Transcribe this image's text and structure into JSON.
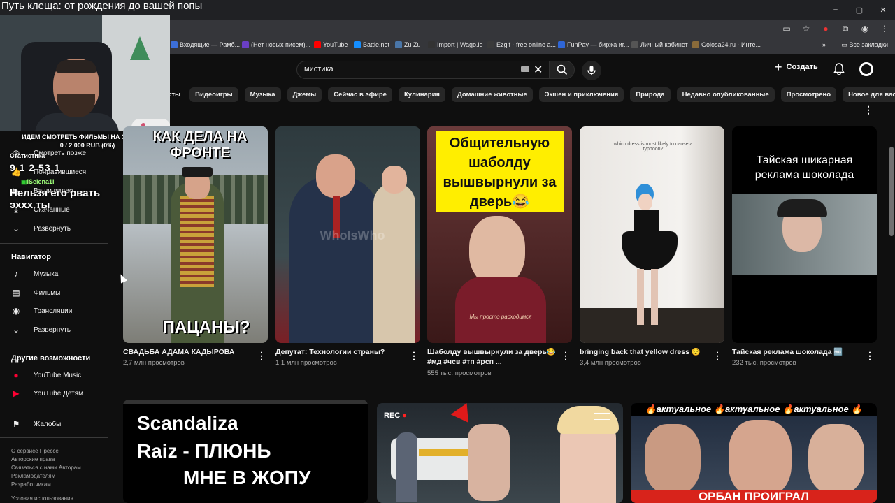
{
  "window": {
    "stream_title": "Путь клеща: от рождения до вашей попы",
    "controls": [
      "⎯",
      "▢",
      "✕"
    ]
  },
  "bookmarks": [
    {
      "label": "Входящие — Рамб...",
      "color": "#3c6fd8"
    },
    {
      "label": "(Нет новых писем)...",
      "color": "#6a3fc4"
    },
    {
      "label": "YouTube",
      "color": "#ff0000"
    },
    {
      "label": "Battle.net",
      "color": "#148eff"
    },
    {
      "label": "Zu Zu",
      "color": "#4a76a8"
    },
    {
      "label": "Import | Wago.io",
      "color": "#333333"
    },
    {
      "label": "Ezgif - free online a...",
      "color": "#3a3a3a"
    },
    {
      "label": "FunPay — биржа иг...",
      "color": "#2f66d6"
    },
    {
      "label": "Личный кабинет",
      "color": "#555555"
    },
    {
      "label": "Golosa24.ru - Инте...",
      "color": "#8a6b3a"
    }
  ],
  "bookmarks_all": "Все закладки",
  "header": {
    "search_value": "мистика",
    "create_label": "Создать"
  },
  "chips": [
    "касты",
    "Видеоигры",
    "Музыка",
    "Джемы",
    "Сейчас в эфире",
    "Кулинария",
    "Домашние животные",
    "Экшен и приключения",
    "Природа",
    "Недавно опубликованные",
    "Просмотрено",
    "Новое для вас"
  ],
  "sidebar": {
    "partial_items": [
      "Смотреть позже",
      "Понравившиеся",
      "Ваши видео",
      "Скачанные"
    ],
    "expand1": "Развернуть",
    "navigator_head": "Навигатор",
    "navigator": [
      {
        "label": "Музыка",
        "icon": "music-icon"
      },
      {
        "label": "Фильмы",
        "icon": "film-icon"
      },
      {
        "label": "Трансляции",
        "icon": "live-icon"
      }
    ],
    "expand2": "Развернуть",
    "other_head": "Другие возможности",
    "other": [
      {
        "label": "YouTube Music",
        "icon": "youtube-music-icon"
      },
      {
        "label": "YouTube Детям",
        "icon": "youtube-kids-icon"
      }
    ],
    "report": "Жалобы",
    "footer1": "О сервисе  Прессе",
    "footer2": "Авторские права",
    "footer3": "Связаться с нами  Авторам",
    "footer4": "Рекламодателям",
    "footer5": "Разработчикам",
    "footer6": "Условия использования"
  },
  "overlay": {
    "goal_title": "ИДЕМ СМОТРЕТЬ ФИЛЬМЫ НА ЗЕЛЕНОМ",
    "goal_progress": "0 / 2 000 RUB (0%)",
    "stats_label": "Статистика",
    "stats_counts": "9 1 2 53  1",
    "chat_user": "ISelena1I",
    "chat_message": "Нельзя его рвать эххх ты"
  },
  "videos_row1": [
    {
      "title": "СВАДЬБА АДАМА КАДЫРОВА",
      "meta": "2,7 млн просмотров",
      "cap_top": "КАК ДЕЛА НА ФРОНТЕ",
      "cap_bottom": "ПАЦАНЫ?"
    },
    {
      "title": "Депутат: Технологии страны?",
      "meta": "1,1 млн просмотров",
      "watermark": "WhoIsWho"
    },
    {
      "title": "Шаболду вышвырнули за дверь😂",
      "title2": "#мд #чсв #тп #рсп ...",
      "meta": "555 тыс. просмотров",
      "cap": "Общительную шаболду вышвырнули за дверь😂",
      "sub": "Мы просто расходимся"
    },
    {
      "title": "bringing back that yellow dress 😌",
      "meta": "3,4 млн просмотров",
      "cap": "which dress is most likely to cause a typhoon?"
    },
    {
      "title": "Тайская реклама шоколада 🆓",
      "meta": "232 тыс. просмотров",
      "cap": "Тайская шикарная реклама шоколада"
    }
  ],
  "videos_row2": [
    {
      "cap1": "Scandaliza",
      "cap2": "Raiz  -  ПЛЮНЬ",
      "cap3": "МНЕ В ЖОПУ"
    },
    {
      "rec": "REC"
    },
    {
      "banner": "🔥актуальное 🔥актуальное 🔥актуальное 🔥",
      "bottom": "ОРБАН ПРОИГРАЛ"
    }
  ]
}
